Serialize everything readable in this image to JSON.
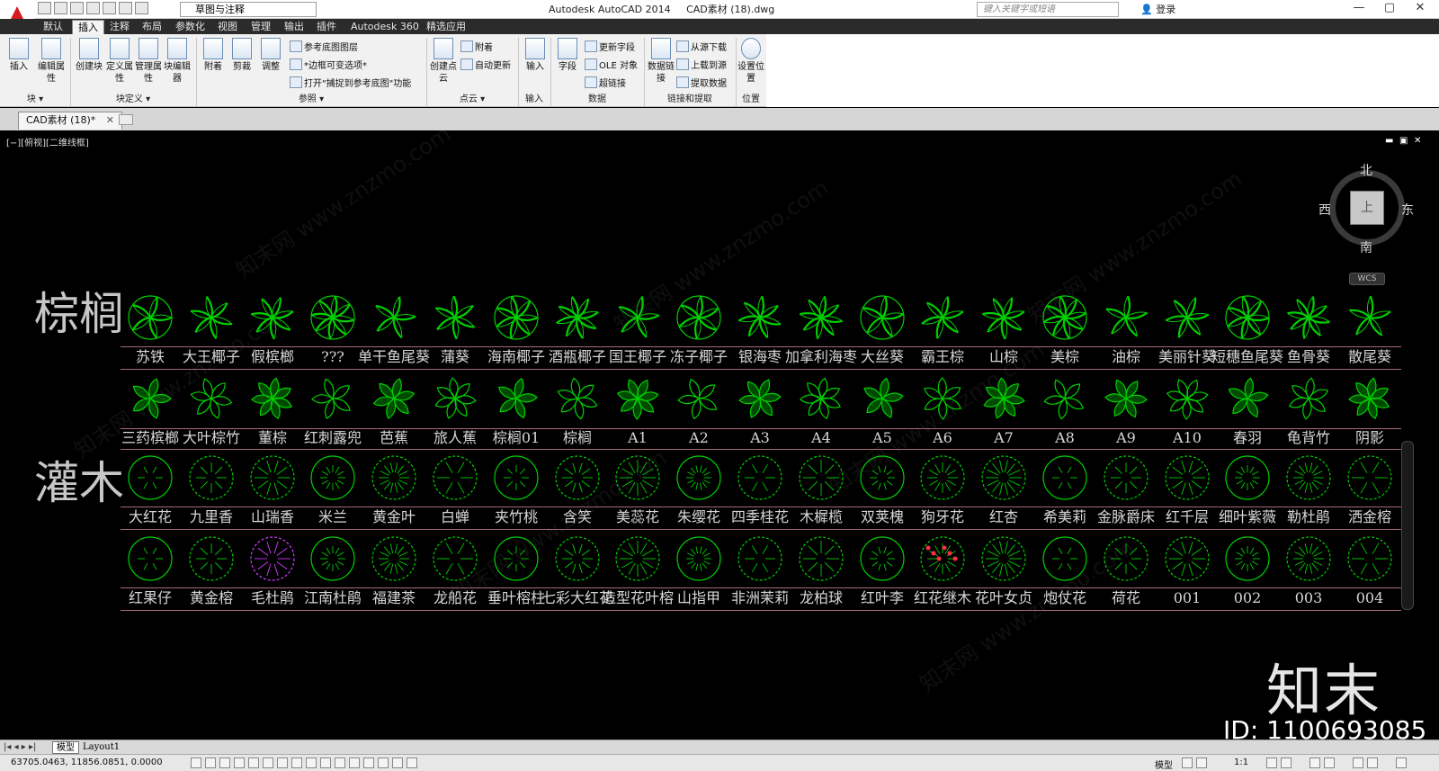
{
  "app": {
    "window_title": "Autodesk AutoCAD 2014",
    "document_title": "CAD素材 (18).dwg",
    "workspace": "草图与注释",
    "search_placeholder": "键入关键字或短语",
    "login": "登录",
    "window_controls": [
      "—",
      "▢",
      "✕"
    ]
  },
  "ribbon_tabs": [
    "默认",
    "插入",
    "注释",
    "布局",
    "参数化",
    "视图",
    "管理",
    "输出",
    "插件",
    "Autodesk 360",
    "精选应用"
  ],
  "active_tab": "插入",
  "ribbon": {
    "tools": {
      "insert": "插入",
      "edit_attr": "编辑属性",
      "create_block": "创建块",
      "define_attr": "定义属性",
      "manage_attr": "管理属性",
      "block_editor": "块编辑器",
      "attach": "附着",
      "clip": "剪裁",
      "adjust": "调整",
      "create_pointcloud": "创建点云",
      "import": "输入",
      "field": "字段",
      "data_link": "数据链接",
      "set_location": "设置位置"
    },
    "small_tools": {
      "underlay_layers": "参考底图图层",
      "frames_vary": "*边框可变选项*",
      "snap_underlay": "打开\"捕捉到参考底图\"功能",
      "pc_attach": "附着",
      "auto_update": "自动更新",
      "update_fields": "更新字段",
      "ole_object": "OLE 对象",
      "hyperlink": "超链接",
      "download_source": "从源下载",
      "upload_source": "上载到源",
      "extract_data": "提取数据"
    },
    "panels": {
      "block": "块 ▾",
      "block_def": "块定义 ▾",
      "reference": "参照 ▾",
      "point_cloud": "点云 ▾",
      "import": "输入",
      "data": "数据",
      "link_extract": "链接和提取",
      "location": "位置"
    }
  },
  "doc_tab": "CAD素材 (18)*",
  "viewport": {
    "label": "[−][俯视][二维线框]",
    "controls": [
      "▬",
      "▣",
      "✕"
    ],
    "viewcube": {
      "north": "北",
      "south": "南",
      "east": "东",
      "west": "西",
      "face": "上"
    },
    "wcs": "WCS"
  },
  "drawing": {
    "section_palms": "棕榈",
    "section_shrubs": "灌木",
    "rows": [
      [
        "苏铁",
        "大王椰子",
        "假槟榔",
        "???",
        "单干鱼尾葵",
        "蒲葵",
        "海南椰子",
        "酒瓶椰子",
        "国王椰子",
        "冻子椰子",
        "银海枣",
        "加拿利海枣",
        "大丝葵",
        "霸王棕",
        "山棕",
        "美棕",
        "油棕",
        "美丽针葵",
        "短穗鱼尾葵",
        "鱼骨葵",
        "散尾葵"
      ],
      [
        "三药槟榔",
        "大叶棕竹",
        "董棕",
        "红刺露兜",
        "芭蕉",
        "旅人蕉",
        "棕榈01",
        "棕榈",
        "A1",
        "A2",
        "A3",
        "A4",
        "A5",
        "A6",
        "A7",
        "A8",
        "A9",
        "A10",
        "春羽",
        "龟背竹",
        "阴影"
      ],
      [
        "大红花",
        "九里香",
        "山瑞香",
        "米兰",
        "黄金叶",
        "白蝉",
        "夹竹桃",
        "含笑",
        "美蕊花",
        "朱缨花",
        "四季桂花",
        "木樨榄",
        "双荚槐",
        "狗牙花",
        "红杏",
        "希美莉",
        "金脉爵床",
        "红千层",
        "细叶紫薇",
        "勒杜鹃",
        "洒金榕"
      ],
      [
        "红果仔",
        "黄金榕",
        "毛杜鹃",
        "江南杜鹃",
        "福建茶",
        "龙船花",
        "垂叶榕柱",
        "七彩大红花",
        "造型花叶榕",
        "山指甲",
        "非洲茉莉",
        "龙柏球",
        "红叶李",
        "红花继木",
        "花叶女贞",
        "炮仗花",
        "荷花",
        "001",
        "002",
        "003",
        "004"
      ]
    ],
    "row_styles": [
      "star",
      "leaf",
      "circle",
      "circle"
    ],
    "accent_green": "#00d000",
    "accent_magenta": "#d13cff",
    "accent_red": "#ff2d4a"
  },
  "watermark": {
    "brand": "知末",
    "id": "ID: 1100693085",
    "site": "知末网 www.znzmo.com"
  },
  "layout_tabs": [
    "模型",
    "Layout1"
  ],
  "status": {
    "coords": "63705.0463, 11856.0851, 0.0000",
    "model_label": "模型",
    "scale": "1:1"
  }
}
